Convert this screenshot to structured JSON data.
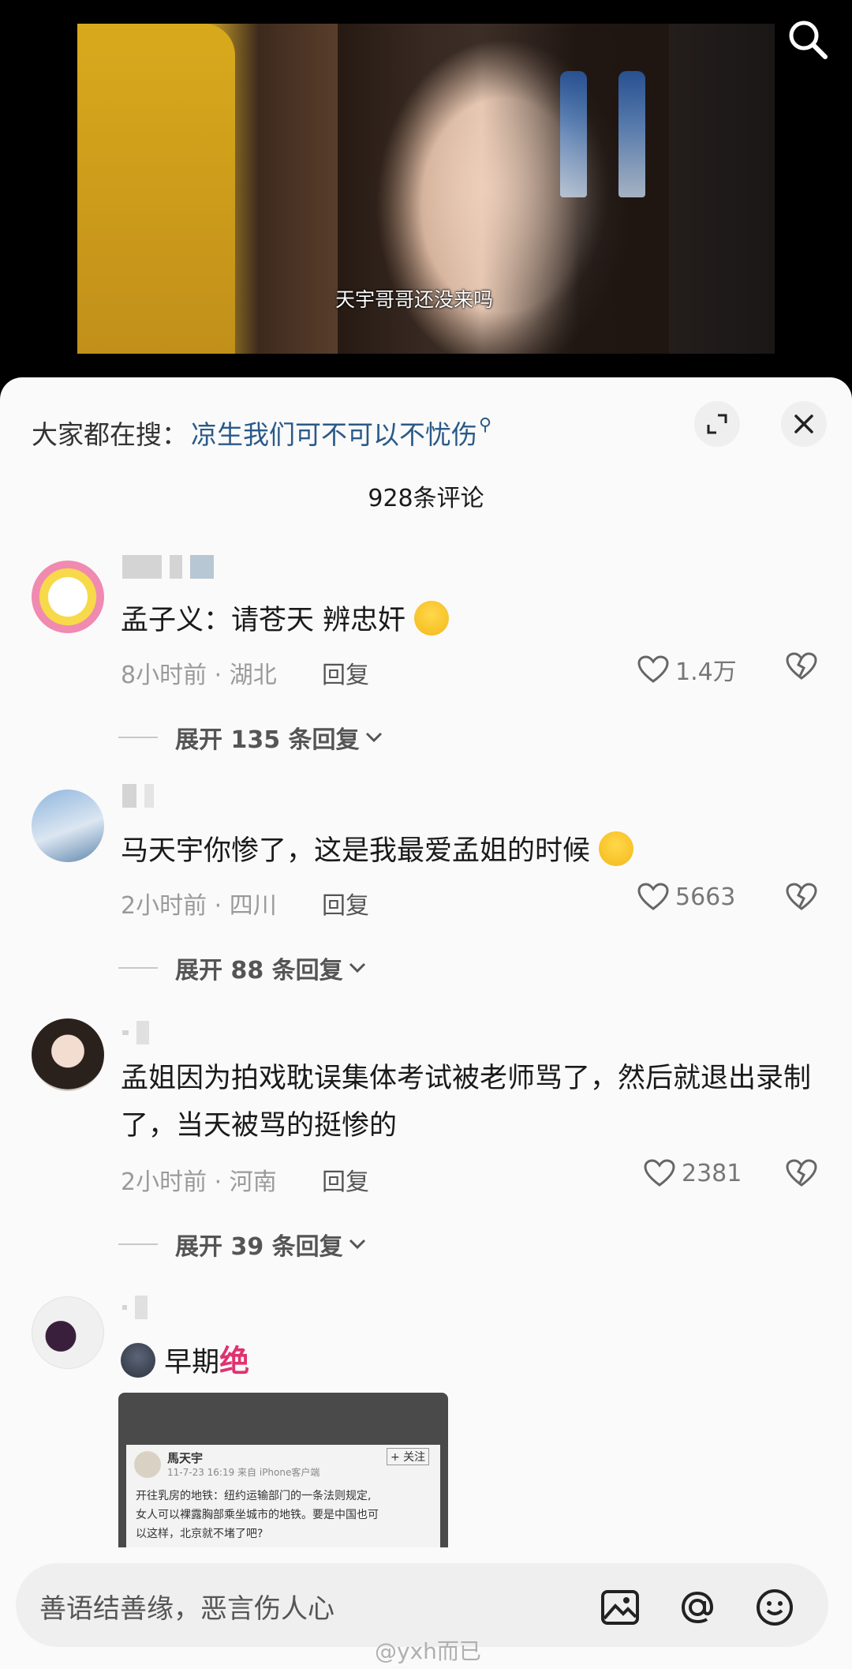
{
  "video": {
    "subtitle": "天宇哥哥还没来吗"
  },
  "sheet": {
    "trend_prefix": "大家都在搜：",
    "trend_query": "凉生我们可不可以不忧伤",
    "comment_count": "928条评论"
  },
  "comments": [
    {
      "text": "孟子义：请苍天 辨忠奸",
      "time_location": "8小时前 · 湖北",
      "reply_label": "回复",
      "likes": "1.4万",
      "expand_label": "展开 135 条回复"
    },
    {
      "text": "马天宇你惨了，这是我最爱孟姐的时候",
      "time_location": "2小时前 · 四川",
      "reply_label": "回复",
      "likes": "5663",
      "expand_label": "展开 88 条回复"
    },
    {
      "text": "孟姐因为拍戏耽误集体考试被老师骂了，然后就退出录制了，当天被骂的挺惨的",
      "time_location": "2小时前 · 河南",
      "reply_label": "回复",
      "likes": "2381",
      "expand_label": "展开 39 条回复"
    },
    {
      "text_prefix": "早期",
      "text_emphasis": "绝"
    }
  ],
  "thumbnail": {
    "name": "馬天宇",
    "follow": "+ 关注",
    "meta": "11-7-23 16:19  来自 iPhone客户端",
    "line1": "开往乳房的地铁：纽约运输部门的一条法则规定,",
    "line2": "女人可以裸露胸部乘坐城市的地铁。要是中国也可",
    "line3": "以这样，北京就不堵了吧?"
  },
  "input": {
    "placeholder": "善语结善缘，恶言伤人心"
  },
  "watermark": "@yxh而已",
  "colors": {
    "link_blue": "#2a5a88",
    "emphasis_pink": "#e0326e",
    "sheet_bg": "#fafafa"
  }
}
